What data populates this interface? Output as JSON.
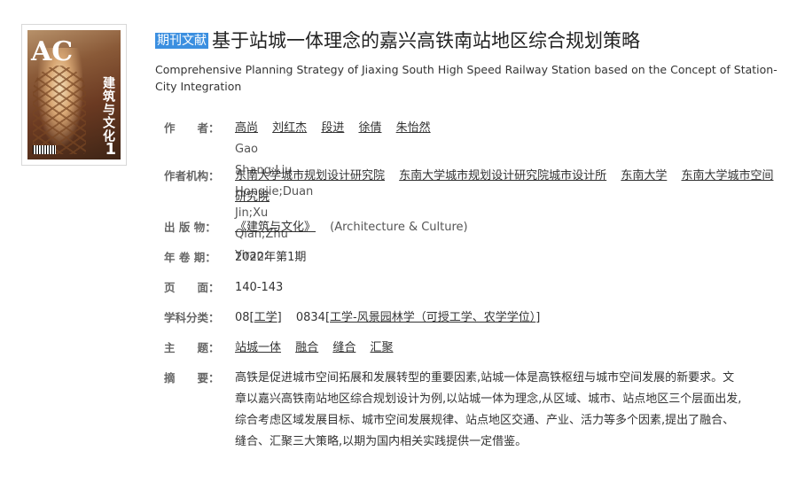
{
  "cover": {
    "alt": "建筑与文化 期刊封面",
    "logo_text": "AC",
    "vertical_title": "建筑与文化",
    "issue_number": "1"
  },
  "article": {
    "tag": "期刊文献",
    "title": "基于站城一体理念的嘉兴高铁南站地区综合规划策略",
    "english_title": "Comprehensive Planning Strategy of Jiaxing South High Speed Railway Station based on the Concept of Station-City Integration"
  },
  "fields": {
    "authors": {
      "label": "作　　者：",
      "names": [
        "高尚",
        "刘红杰",
        "段进",
        "徐倩",
        "朱怡然"
      ],
      "pinyin": "Gao Shang;Liu Hongjie;Duan Jin;Xu Qian;Zhu Yiran;"
    },
    "institutions": {
      "label": "作者机构：",
      "items": [
        "东南大学城市规划设计研究院",
        "东南大学城市规划设计研究院城市设计所",
        "东南大学",
        "东南大学城市空间研究院"
      ]
    },
    "publication": {
      "label": "出 版 物：",
      "name": "《建筑与文化》",
      "english": "(Architecture & Culture)"
    },
    "year_issue": {
      "label": "年 卷 期：",
      "value": "2022年第1期"
    },
    "pages": {
      "label": "页　　面：",
      "value": "140-143"
    },
    "subject": {
      "label": "学科分类：",
      "code1": "08",
      "name1": "工学",
      "code2": "0834",
      "name2": "工学-风景园林学（可授工学、农学学位）"
    },
    "keywords": {
      "label": "主　　题：",
      "items": [
        "站城一体",
        "融合",
        "缝合",
        "汇聚"
      ]
    },
    "abstract": {
      "label": "摘　　要：",
      "lines": [
        "高铁是促进城市空间拓展和发展转型的重要因素,站城一体是高铁枢纽与城市空间发展的新要求。文",
        "章以嘉兴高铁南站地区综合规划设计为例,以站城一体为理念,从区域、城市、站点地区三个层面出发,",
        "综合考虑区域发展目标、城市空间发展规律、站点地区交通、产业、活力等多个因素,提出了融合、",
        "缝合、汇聚三大策略,以期为国内相关实践提供一定借鉴。"
      ]
    }
  }
}
